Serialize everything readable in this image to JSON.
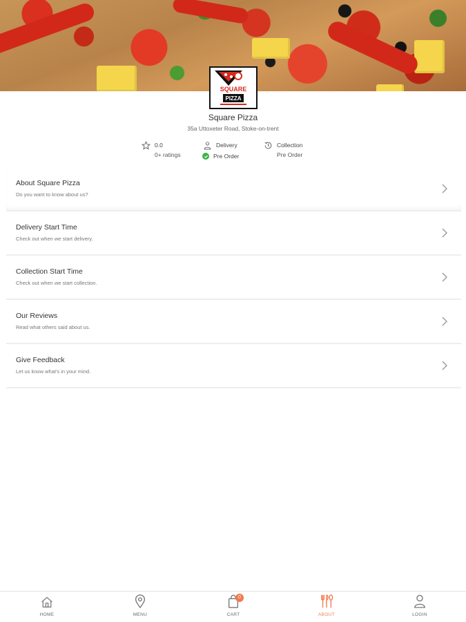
{
  "store": {
    "name": "Square Pizza",
    "address": "35a Uttoxeter Road, Stoke-on-trent",
    "logo": {
      "top_text": "SQUARE",
      "bottom_text": "PIZZA"
    }
  },
  "stats": {
    "rating": {
      "value": "0.0",
      "sub": "0+ ratings",
      "icon": "star-icon"
    },
    "delivery": {
      "label": "Delivery",
      "sub": "Pre Order",
      "icon": "delivery-person-icon",
      "sub_icon": "check-circle-icon"
    },
    "collection": {
      "label": "Collection",
      "sub": "Pre Order",
      "icon": "history-clock-icon"
    }
  },
  "menu_items": [
    {
      "title": "About Square Pizza",
      "subtitle": "Do you want to know about us?"
    },
    {
      "title": "Delivery Start Time",
      "subtitle": "Check out when we start delivery."
    },
    {
      "title": "Collection Start Time",
      "subtitle": "Check out when we start collection."
    },
    {
      "title": "Our Reviews",
      "subtitle": "Read what others said about us."
    },
    {
      "title": "Give Feedback",
      "subtitle": "Let us know what's in your mind."
    }
  ],
  "tabbar": {
    "home": "HOME",
    "menu": "MENU",
    "cart": "CART",
    "cart_count": "0",
    "about": "ABOUT",
    "login": "LOGIN",
    "active": "about"
  },
  "colors": {
    "accent": "#f07b4e",
    "check": "#3bb54a",
    "divider": "#eeeeee"
  }
}
